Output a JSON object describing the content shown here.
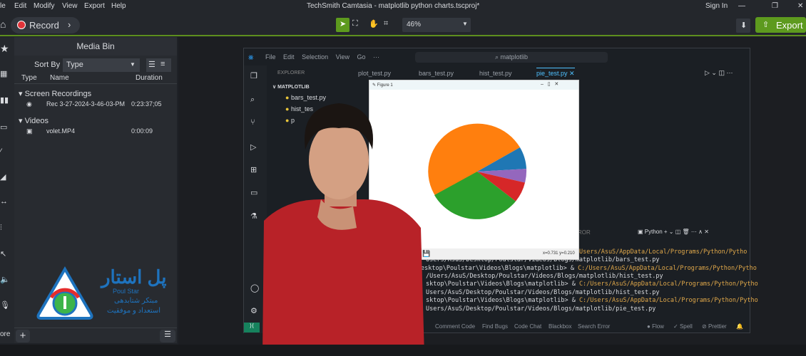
{
  "menu": {
    "items": [
      "le",
      "Edit",
      "Modify",
      "View",
      "Export",
      "Help"
    ],
    "title": "TechSmith Camtasia - matplotlib python charts.tscproj*",
    "sign_in": "Sign In"
  },
  "toolbar": {
    "record": "Record",
    "zoom": "46%",
    "export": "Export",
    "accent": "#5d9a1e"
  },
  "media_bin": {
    "title": "Media Bin",
    "sort_by": "Sort By",
    "sort_value": "Type",
    "columns": [
      "Type",
      "Name",
      "Duration"
    ],
    "groups": [
      {
        "name": "Screen Recordings",
        "items": [
          {
            "name": "Rec 3-27-2024-3-46-03-PM",
            "duration": "0:23:37;05"
          }
        ]
      },
      {
        "name": "Videos",
        "items": [
          {
            "name": "volet.MP4",
            "duration": "0:00:09"
          }
        ]
      }
    ],
    "more": "ore"
  },
  "logo": {
    "fa_name": "پل استار",
    "en_name": "Poul Star",
    "tagline1": "مبتکر شتابدهی",
    "tagline2": "استعداد و موفقیت"
  },
  "vscode": {
    "menu": [
      "File",
      "Edit",
      "Selection",
      "View",
      "Go",
      "···"
    ],
    "search": "matplotlib",
    "explorer": "EXPLORER",
    "folder": "MATPLOTLIB",
    "files": [
      "bars_test.py",
      "hist_tes",
      "p",
      "p"
    ],
    "tabs": [
      "plot_test.py",
      "bars_test.py",
      "hist_test.py",
      "pie_test.py"
    ],
    "terminal_label": "Python",
    "panel_tab": "ROR",
    "terminal": [
      {
        "a": "",
        "b": "Users/AsuS/AppData/Local/Programs/Python/Pytho"
      },
      {
        "a": "Users/AsuS/Desktop/Poulstar/Videos/Blogs/matplotlib/bars_test.py",
        "b": ""
      },
      {
        "a": "esktop\\Poulstar\\Videos\\Blogs\\matplotlib> & ",
        "b": "C:/Users/AsuS/AppData/Local/Programs/Python/Pytho"
      },
      {
        "a": "/Users/AsuS/Desktop/Poulstar/Videos/Blogs/matplotlib/hist_test.py",
        "b": ""
      },
      {
        "a": "sktop\\Poulstar\\Videos\\Blogs\\matplotlib> & ",
        "b": "C:/Users/AsuS/AppData/Local/Programs/Python/Pytho"
      },
      {
        "a": "Users/AsuS/Desktop/Poulstar/Videos/Blogs/matplotlib/hist_test.py",
        "b": ""
      },
      {
        "a": "sktop\\Poulstar\\Videos\\Blogs\\matplotlib> & ",
        "b": "C:/Users/AsuS/AppData/Local/Programs/Python/Pytho"
      },
      {
        "a": "Users/AsuS/Desktop/Poulstar/Videos/Blogs/matplotlib/pie_test.py",
        "b": ""
      }
    ],
    "status": [
      "e",
      "Comment Code",
      "Find Bugs",
      "Code Chat",
      "Blackbox",
      "Search Error"
    ],
    "status_right": [
      "Flow",
      "Spell",
      "Prettier"
    ]
  },
  "figure": {
    "title": "Figure 1",
    "coords": "x=0.731 y=0.210",
    "slice_colors": [
      "#ff7f0e",
      "#1f77b4",
      "#9467bd",
      "#d62728",
      "#2ca02c"
    ]
  }
}
